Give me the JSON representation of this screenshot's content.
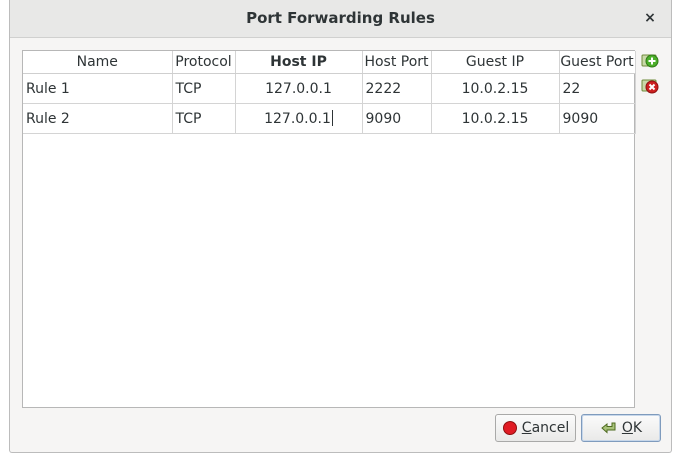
{
  "window": {
    "title": "Port Forwarding Rules",
    "close_glyph": "×"
  },
  "table": {
    "columns": [
      "Name",
      "Protocol",
      "Host IP",
      "Host Port",
      "Guest IP",
      "Guest Port"
    ],
    "sorted_column": "Host IP",
    "rows": [
      {
        "name": "Rule 1",
        "protocol": "TCP",
        "host_ip": "127.0.0.1",
        "host_port": "2222",
        "guest_ip": "10.0.2.15",
        "guest_port": "22"
      },
      {
        "name": "Rule 2",
        "protocol": "TCP",
        "host_ip": "127.0.0.1",
        "host_port": "9090",
        "guest_ip": "10.0.2.15",
        "guest_port": "9090"
      }
    ]
  },
  "side_buttons": {
    "add_icon": "add-rule-icon",
    "remove_icon": "remove-rule-icon"
  },
  "buttons": {
    "cancel": {
      "mnemonic": "C",
      "rest": "ancel",
      "icon": "cancel-icon"
    },
    "ok": {
      "mnemonic": "O",
      "rest": "K",
      "icon": "ok-icon"
    }
  },
  "colors": {
    "add_green": "#4caf2a",
    "remove_red": "#cc1f1f",
    "cancel_red": "#e01b24"
  }
}
